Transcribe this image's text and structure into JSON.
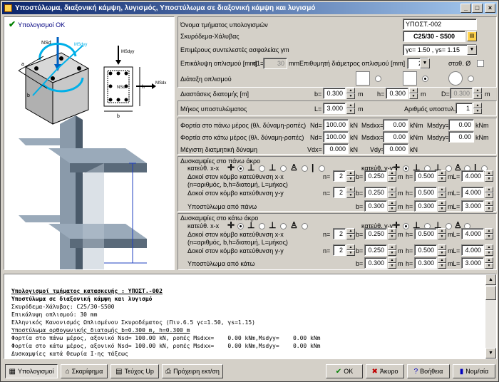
{
  "window": {
    "title": "Υποστύλωμα, διαξονική κάμψη, λυγισμός, Υποστύλωμα σε διαξονική κάμψη και λυγισμό"
  },
  "left": {
    "ok_label": "Υπολογισμοί ΟΚ",
    "labels": {
      "nsd_top": "NSd",
      "msdxx": "MSdxx",
      "msdyy": "MSdyy",
      "nsd": "NSd",
      "msdx": "MSdx",
      "h": "h",
      "b": "b",
      "a": "a"
    }
  },
  "form": {
    "name_label": "Όνομα τμήματος υπολογισμών",
    "name_value": "ΥΠΟΣΤ.-002",
    "material_label": "Σκυρόδεμα-Χάλυβας",
    "material_value": "C25/30 - S500",
    "safety_label": "Επιμέρους συντελεστές ασφαλείας γm",
    "safety_value": "γc= 1.50 , γs= 1.15",
    "cover_label": "Επικάλυψη οπλισμού [mm]",
    "d1_label": "d1=",
    "d1_value": "30",
    "diam_label": "mmΕπιθυμητή διάμετρος οπλισμού [mm] Ø",
    "diam_value": "20",
    "const_label": "σταθ. Ø",
    "arrangement_label": "Διάταξη οπλισμού",
    "dims_label": "Διαστάσεις διατομής [m]",
    "b_label": "b=",
    "b_value": "0.300",
    "h_label": "h=",
    "h_value": "0.300",
    "D_label": "D=",
    "D_value": "0.300",
    "m": "m",
    "length_label": "Μήκος υποστυλώματος",
    "L_label": "L=",
    "L_value": "3.000",
    "count_label": "Αριθμός υποστυλ.",
    "count_value": "1",
    "top_load_label": "Φορτία στο πάνω μέρος (θλ. δύναμη-ροπές)",
    "bot_load_label": "Φορτία στο κάτω μέρος (θλ. δύναμη-ροπές)",
    "nd_label": "Nd=",
    "nd_top": "100.00",
    "nd_bot": "100.00",
    "kN": "kN",
    "kNm": "kNm",
    "msdxx_label": "Msdxx=",
    "msdxx_top": "0.00",
    "msdxx_bot": "0.00",
    "msdyy_label": "Msdyy=",
    "msdyy_top": "0.00",
    "msdyy_bot": "0.00",
    "shear_label": "Μέγιστη διατμητική δύναμη",
    "vdx_label": "Vdx=",
    "vdx_value": "0.000",
    "vdy_label": "Vdy=",
    "vdy_value": "0.000",
    "top_stiff_label": "Δυσκαμψίες στο πάνω άκρο",
    "bot_stiff_label": "Δυσκαμψίες στο κάτω άκρο",
    "dir_xx": "κατεύθ. x-x",
    "dir_yy": "κατεύθ. y-y",
    "beams_xx_label": "Δοκοί στον κόμβο κατεύθυνση x-x",
    "beams_note": "(n=αριθμός, b,h=διατομή, L=μήκος)",
    "beams_yy_label": "Δοκοί στον κόμβο κατεύθυνση y-y",
    "col_top_label": "Υποστύλωμα από πάνω",
    "col_bot_label": "Υποστύλωμα από κάτω",
    "n_label": "n=",
    "n_value": "2",
    "bh_b": "0.250",
    "bh_h": "0.500",
    "L4": "4.000",
    "col_b": "0.300",
    "col_h": "0.300",
    "col_L": "3.000"
  },
  "output": {
    "lines": [
      {
        "t": "Υπολογισμοί τμήματος κατασκευής : ΥΠΟΣΤ.-002",
        "b": true
      },
      {
        "t": "Υποστύλωμα σε διαξονική κάμψη και λυγισμό",
        "b": false,
        "bold": true
      },
      {
        "t": "Σκυρόδεμα-Χάλυβας: C25/30-S500",
        "b": false
      },
      {
        "t": "Επικάλυψη οπλισμού: 30 mm",
        "b": false
      },
      {
        "t": "Ελληνικός Κανονισμός Ωπλισμένου Σκυροδέματος (Πιν.6.5 γc=1.50, γs=1.15)",
        "b": false
      },
      {
        "t": "Υποστύλωμα ορθογωνικής διατομής b=0.300 m, h=0.300 m",
        "b": false,
        "u": true
      },
      {
        "t": "Φορτία στο πάνω μέρος, αξονικό Nsd= 100.00 kN, ροπές Msdxx=    0.00 kNm,Msdyy=    0.00 kNm",
        "b": false
      },
      {
        "t": "Φορτία στο κάτω μέρος, αξονικό Nsd= 100.00 kN, ροπές Msdxx=    0.00 kNm,Msdyy=    0.00 kNm",
        "b": false
      },
      {
        "t": "Δυσκαμψίες κατά Θεωρία Ι-ης τάξεως",
        "b": false
      }
    ]
  },
  "buttons": {
    "calc": "Υπολογισμοί",
    "sketch": "Σκαρίφημα",
    "report": "Τεύχος Up",
    "draft": "Πρόχειρη εκτ/ση",
    "ok": "ΟΚ",
    "cancel": "Άκυρο",
    "help": "Βοήθεια",
    "units": "Νομ/σία"
  },
  "colors": {
    "title_start": "#0a246a",
    "title_end": "#a6caf0",
    "arrow": "#00b0e8",
    "steel": "#5a6a7a"
  }
}
